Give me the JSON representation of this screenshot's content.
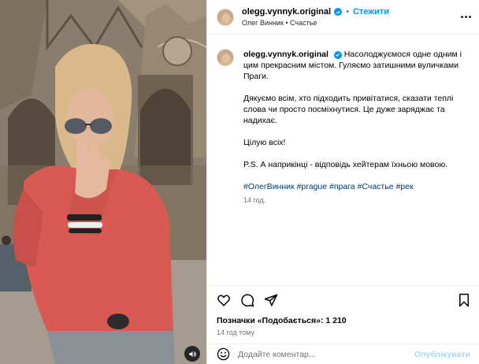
{
  "post": {
    "username": "olegg.vynnyk.original",
    "follow_label": "Стежити",
    "separator": "•",
    "subline": "Олег Винник • Счастье"
  },
  "caption": {
    "username": "olegg.vynnyk.original",
    "paragraph1": "Насолоджуємося одне одним і цим прекрасним містом. Гуляємо затишними вуличками Праги.",
    "paragraph2": "Дякуємо всім, хто підходить привітатися, сказати теплі слова чи просто посміхнутися. Це дуже заряджає та надихає.",
    "paragraph3": "Цілую всіх!",
    "paragraph4": "P.S. А наприкінці - відповідь хейтерам їхньою мовою.",
    "hashtags": "#ОлегВинник #prague #прага #Счастье #рек",
    "time": "14 год."
  },
  "stats": {
    "likes_text": "Позначки «Подобається»: 1 210",
    "posted_ago": "14 год тому"
  },
  "comment": {
    "placeholder": "Додайте коментар...",
    "publish_label": "Опублікувати"
  },
  "colors": {
    "accent": "#0095f6",
    "hashtag": "#00376b",
    "publish_disabled": "#a8d6fb"
  },
  "icons": [
    "verified-icon",
    "more-options-icon",
    "heart-icon",
    "comment-icon",
    "share-icon",
    "bookmark-icon",
    "emoji-icon",
    "audio-icon"
  ]
}
